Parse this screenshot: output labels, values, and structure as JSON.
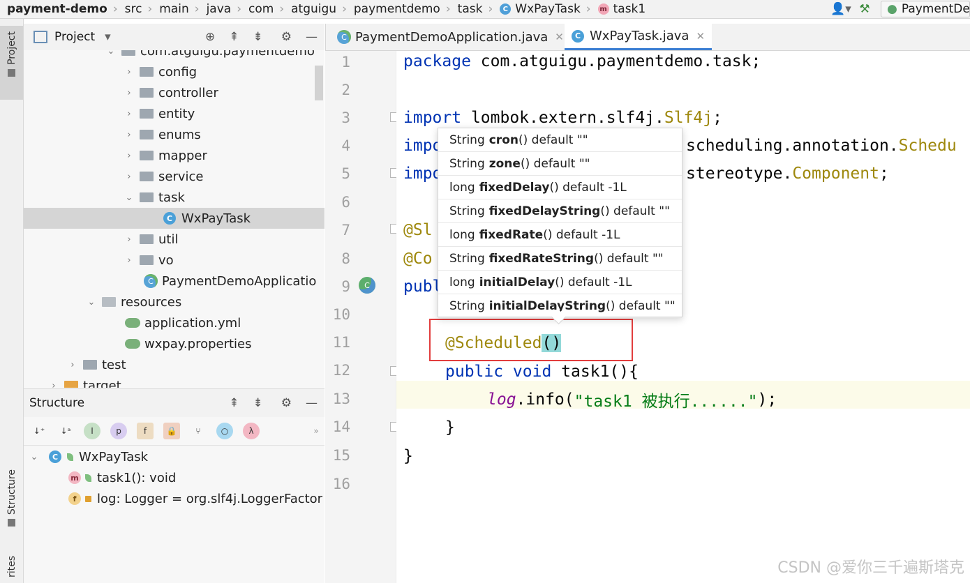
{
  "breadcrumb": [
    "payment-demo",
    "src",
    "main",
    "java",
    "com",
    "atguigu",
    "paymentdemo",
    "task",
    "WxPayTask",
    "task1"
  ],
  "run_config": "PaymentDe",
  "left_strip": {
    "project": "Project",
    "structure": "Structure",
    "favorites": "rites"
  },
  "project_panel": {
    "title": "Project",
    "tree": [
      {
        "label": "com.atguigu.paymentdemo",
        "indent": 1,
        "type": "folder"
      },
      {
        "label": "config",
        "indent": 2,
        "type": "folder"
      },
      {
        "label": "controller",
        "indent": 2,
        "type": "folder"
      },
      {
        "label": "entity",
        "indent": 2,
        "type": "folder"
      },
      {
        "label": "enums",
        "indent": 2,
        "type": "folder"
      },
      {
        "label": "mapper",
        "indent": 2,
        "type": "folder"
      },
      {
        "label": "service",
        "indent": 2,
        "type": "folder"
      },
      {
        "label": "task",
        "indent": 2,
        "type": "folder"
      },
      {
        "label": "WxPayTask",
        "indent": 3,
        "type": "class"
      },
      {
        "label": "util",
        "indent": 2,
        "type": "folder"
      },
      {
        "label": "vo",
        "indent": 2,
        "type": "folder"
      },
      {
        "label": "PaymentDemoApplicatio",
        "indent": 2,
        "type": "app"
      },
      {
        "label": "resources",
        "indent": 1,
        "type": "folder"
      },
      {
        "label": "application.yml",
        "indent": 2,
        "type": "yml"
      },
      {
        "label": "wxpay.properties",
        "indent": 2,
        "type": "yml"
      },
      {
        "label": "test",
        "indent": 0,
        "type": "folder"
      },
      {
        "label": "target",
        "indent": 0,
        "type": "folder"
      }
    ]
  },
  "structure_panel": {
    "title": "Structure",
    "items": [
      {
        "label": "WxPayTask"
      },
      {
        "label": "task1(): void"
      },
      {
        "label": "log: Logger = org.slf4j.LoggerFactor"
      }
    ]
  },
  "tabs": [
    {
      "label": "PaymentDemoApplication.java",
      "active": false
    },
    {
      "label": "WxPayTask.java",
      "active": true
    }
  ],
  "editor": {
    "line_numbers": [
      "1",
      "2",
      "3",
      "4",
      "5",
      "6",
      "7",
      "8",
      "9",
      "10",
      "11",
      "12",
      "13",
      "14",
      "15",
      "16"
    ],
    "code": {
      "l1_kw": "package",
      "l1_rest": " com.atguigu.paymentdemo.task;",
      "l3_kw": "import",
      "l3_mid": " lombok.extern.slf4j.",
      "l3_cls": "Slf4j",
      "l3_end": ";",
      "l4_kw": "impo",
      "l4_rest": "scheduling.annotation.",
      "l4_cls": "Schedu",
      "l5_kw": "impo",
      "l5_rest": "stereotype.",
      "l5_cls": "Component",
      "l5_end": ";",
      "l7": "@Sl",
      "l8": "@Co",
      "l9_kw": "publ",
      "l11_ann": "@Scheduled",
      "l11_paren": "()",
      "l12_kw": "public void",
      "l12_rest": " task1(){",
      "l13_field": "log",
      "l13_mid": ".info(",
      "l13_str": "\"task1 被执行......\"",
      "l13_end": ");",
      "l14": "}",
      "l15": "}"
    }
  },
  "param_popup": [
    {
      "type": "String",
      "name": "cron",
      "tail": "() default \"\""
    },
    {
      "type": "String",
      "name": "zone",
      "tail": "() default \"\""
    },
    {
      "type": "long",
      "name": "fixedDelay",
      "tail": "() default -1L"
    },
    {
      "type": "String",
      "name": "fixedDelayString",
      "tail": "() default \"\""
    },
    {
      "type": "long",
      "name": "fixedRate",
      "tail": "() default -1L"
    },
    {
      "type": "String",
      "name": "fixedRateString",
      "tail": "() default \"\""
    },
    {
      "type": "long",
      "name": "initialDelay",
      "tail": "() default -1L"
    },
    {
      "type": "String",
      "name": "initialDelayString",
      "tail": "() default \"\""
    }
  ],
  "watermark": "CSDN @爱你三千遍斯塔克"
}
